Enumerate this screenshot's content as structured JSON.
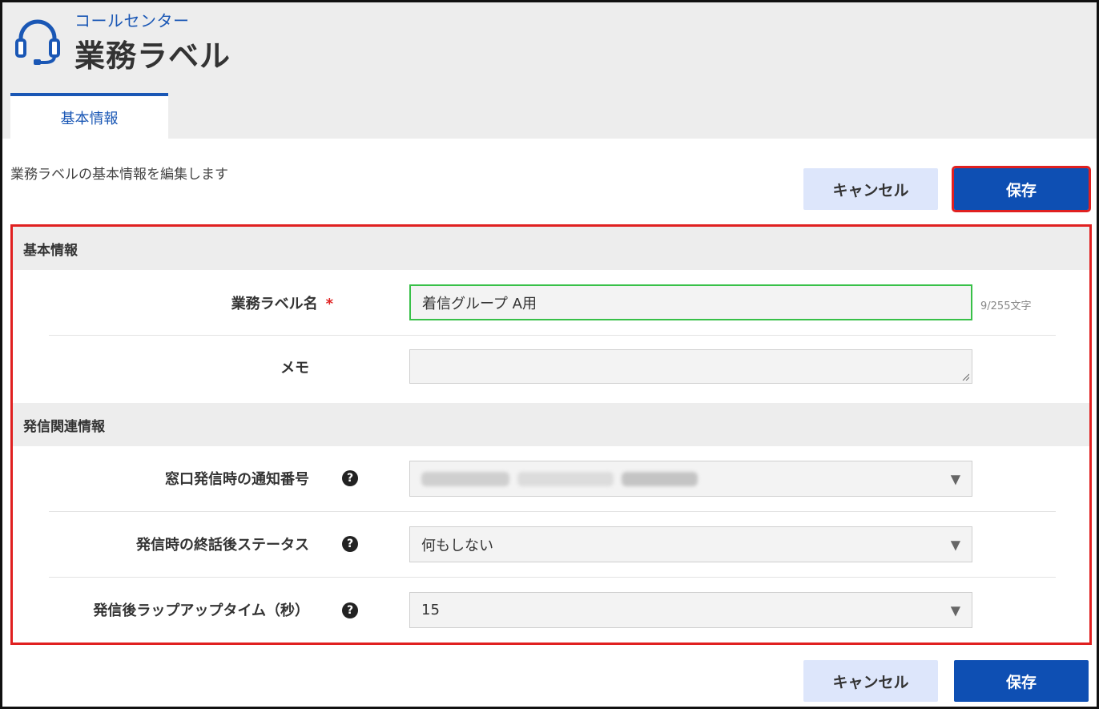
{
  "header": {
    "subtitle": "コールセンター",
    "title": "業務ラベル",
    "icon": "headset-icon"
  },
  "tabs": [
    {
      "label": "基本情報",
      "active": true
    }
  ],
  "intro": {
    "description": "業務ラベルの基本情報を編集します"
  },
  "actions": {
    "cancel_label": "キャンセル",
    "save_label": "保存"
  },
  "form": {
    "basic_section": {
      "title": "基本情報",
      "label_name": {
        "label": "業務ラベル名",
        "required_mark": "*",
        "value": "着信グループ A用",
        "char_count": "9/255文字"
      },
      "memo": {
        "label": "メモ",
        "value": ""
      }
    },
    "outbound_section": {
      "title": "発信関連情報",
      "notify_number": {
        "label": "窓口発信時の通知番号",
        "help": "?",
        "value": ""
      },
      "after_call_status": {
        "label": "発信時の終話後ステータス",
        "help": "?",
        "value": "何もしない"
      },
      "wrapup_time": {
        "label": "発信後ラップアップタイム（秒）",
        "help": "?",
        "value": "15"
      }
    }
  },
  "colors": {
    "accent": "#1a57b5",
    "save_button": "#0e4fb3",
    "cancel_button": "#dde6fb",
    "highlight": "#e02020",
    "focus": "#38c048"
  }
}
